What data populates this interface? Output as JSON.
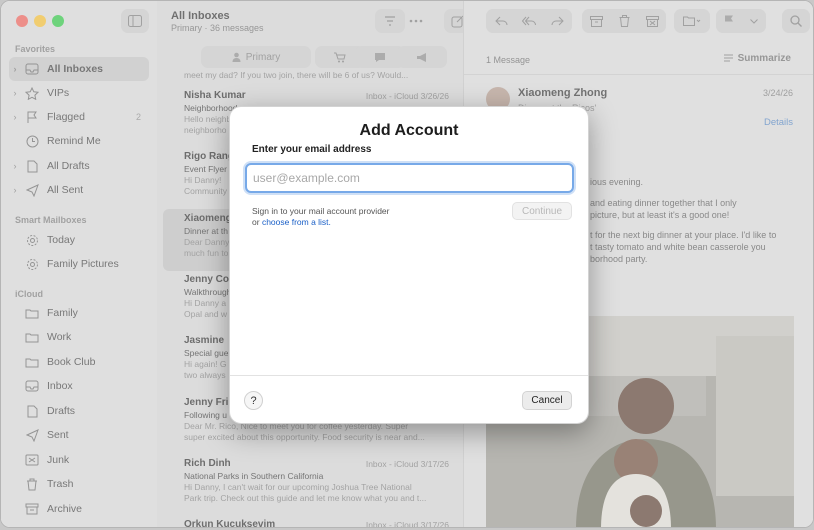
{
  "sidebar": {
    "favorites_heading": "Favorites",
    "favorites": [
      {
        "label": "All Inboxes",
        "icon": "tray-icon",
        "selected": true
      },
      {
        "label": "VIPs",
        "icon": "star-icon"
      },
      {
        "label": "Flagged",
        "icon": "flag-icon",
        "count": "2"
      },
      {
        "label": "Remind Me",
        "icon": "clock-icon"
      },
      {
        "label": "All Drafts",
        "icon": "doc-icon"
      },
      {
        "label": "All Sent",
        "icon": "paperplane-icon"
      }
    ],
    "smart_heading": "Smart Mailboxes",
    "smart": [
      {
        "label": "Today",
        "icon": "gear-icon"
      },
      {
        "label": "Family Pictures",
        "icon": "gear-icon"
      }
    ],
    "icloud_heading": "iCloud",
    "icloud": [
      {
        "label": "Family",
        "icon": "folder-icon"
      },
      {
        "label": "Work",
        "icon": "folder-icon"
      },
      {
        "label": "Book Club",
        "icon": "folder-icon"
      },
      {
        "label": "Inbox",
        "icon": "inbox-icon"
      },
      {
        "label": "Drafts",
        "icon": "doc-icon"
      },
      {
        "label": "Sent",
        "icon": "paperplane-icon"
      },
      {
        "label": "Junk",
        "icon": "junk-icon"
      },
      {
        "label": "Trash",
        "icon": "trash-icon"
      },
      {
        "label": "Archive",
        "icon": "archive-icon"
      }
    ]
  },
  "list": {
    "title": "All Inboxes",
    "subtitle": "Primary · 36 messages",
    "tab_primary": "Primary",
    "top_preview": "meet my dad? If you two join, there will be 6 of us? Would...",
    "messages": [
      {
        "from": "Nisha Kumar",
        "meta": "Inbox - iCloud   3/26/26",
        "subject": "Neighborhood",
        "preview": "Hello neighbo\nneighborho"
      },
      {
        "from": "Rigo Rangel",
        "meta": "",
        "subject": "Event Flyer",
        "preview": "Hi Danny!\nCommunity"
      },
      {
        "from": "Xiaomeng",
        "meta": "",
        "subject": "Dinner at th",
        "preview": "Dear Danny,\nmuch fun to"
      },
      {
        "from": "Jenny Co",
        "meta": "",
        "subject": "Walkthrough",
        "preview": "Hi Danny a\nOpal and w"
      },
      {
        "from": "Jasmine",
        "meta": "",
        "subject": "Special gue",
        "preview": "Hi again! G\ntwo always"
      },
      {
        "from": "Jenny Fri",
        "meta": "",
        "subject": "Following u",
        "preview": "Dear Mr. Rico, Nice to meet you for coffee yesterday. Super\nsuper excited about this opportunity. Food security is near and..."
      },
      {
        "from": "Rich Dinh",
        "meta": "Inbox - iCloud   3/17/26",
        "subject": "National Parks in Southern California",
        "preview": "Hi Danny, I can't wait for our upcoming Joshua Tree National\nPark trip. Check out this guide and let me know what you and t..."
      },
      {
        "from": "Orkun Kucuksevim",
        "meta": "Inbox - iCloud   3/17/26",
        "subject": "",
        "preview": ""
      }
    ]
  },
  "reader": {
    "count": "1 Message",
    "summarize": "Summarize",
    "sender": "Xiaomeng Zhong",
    "sender_sub": "Dinner at the Ricos'",
    "date": "3/24/26",
    "details": "Details",
    "line1": "ious evening.",
    "para1": "and eating dinner together that I only\npicture, but at least it's a good one!",
    "para2": "t for the next big dinner at your place. I'd like to\nt tasty tomato and white bean casserole you\nborhood party."
  },
  "modal": {
    "title": "Add Account",
    "label": "Enter your email address",
    "placeholder": "user@example.com",
    "hint_text": "Sign in to your mail account provider",
    "hint_or": "or",
    "hint_link": "choose from a list.",
    "continue": "Continue",
    "help": "?",
    "cancel": "Cancel"
  },
  "colors": {
    "accent": "#1a5fc7",
    "focus_ring": "#77a9e8",
    "traffic_close": "#ee5f57",
    "traffic_min": "#f5bd2f",
    "traffic_max": "#2bc741"
  }
}
